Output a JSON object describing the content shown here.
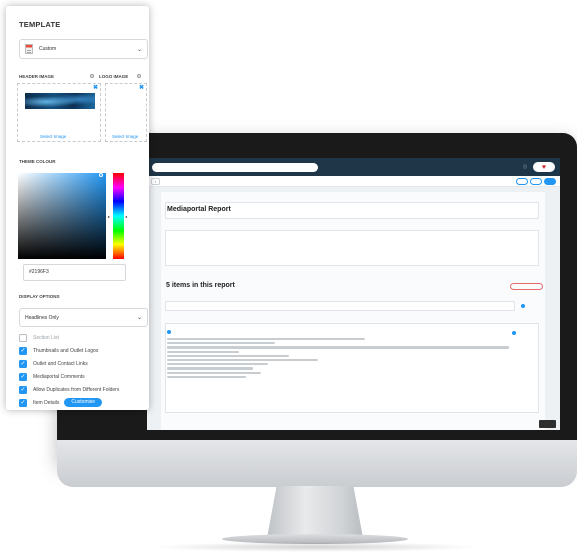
{
  "template_panel": {
    "heading": "TEMPLATE",
    "template_select": {
      "value": "Custom",
      "icon": "template-icon"
    },
    "header_image": {
      "label": "HEADER IMAGE",
      "select_label": "Select Image"
    },
    "logo_image": {
      "label": "LOGO IMAGE",
      "select_label": "Select Image"
    },
    "theme_colour": {
      "label": "THEME COLOUR",
      "hex_value": "#2196F3",
      "color": "#2196f3"
    },
    "display_options": {
      "label": "DISPLAY OPTIONS",
      "select_value": "Headlines Only",
      "options": [
        {
          "label": "Section List",
          "checked": false
        },
        {
          "label": "Thumbnails and Outlet Logos",
          "checked": true
        },
        {
          "label": "Outlet and Contact Links",
          "checked": true
        },
        {
          "label": "Mediaportal Comments",
          "checked": true
        },
        {
          "label": "Allow Duplicates from Different Folders",
          "checked": true
        },
        {
          "label": "Item Details",
          "checked": true
        }
      ],
      "customise_label": "Customise"
    }
  },
  "app_screen": {
    "report_title": "Mediaportal Report",
    "items_heading": "5 items in this report"
  },
  "colors": {
    "accent": "#2196f3",
    "nav_dark": "#1f3649",
    "remove_red": "#e36b6b"
  }
}
